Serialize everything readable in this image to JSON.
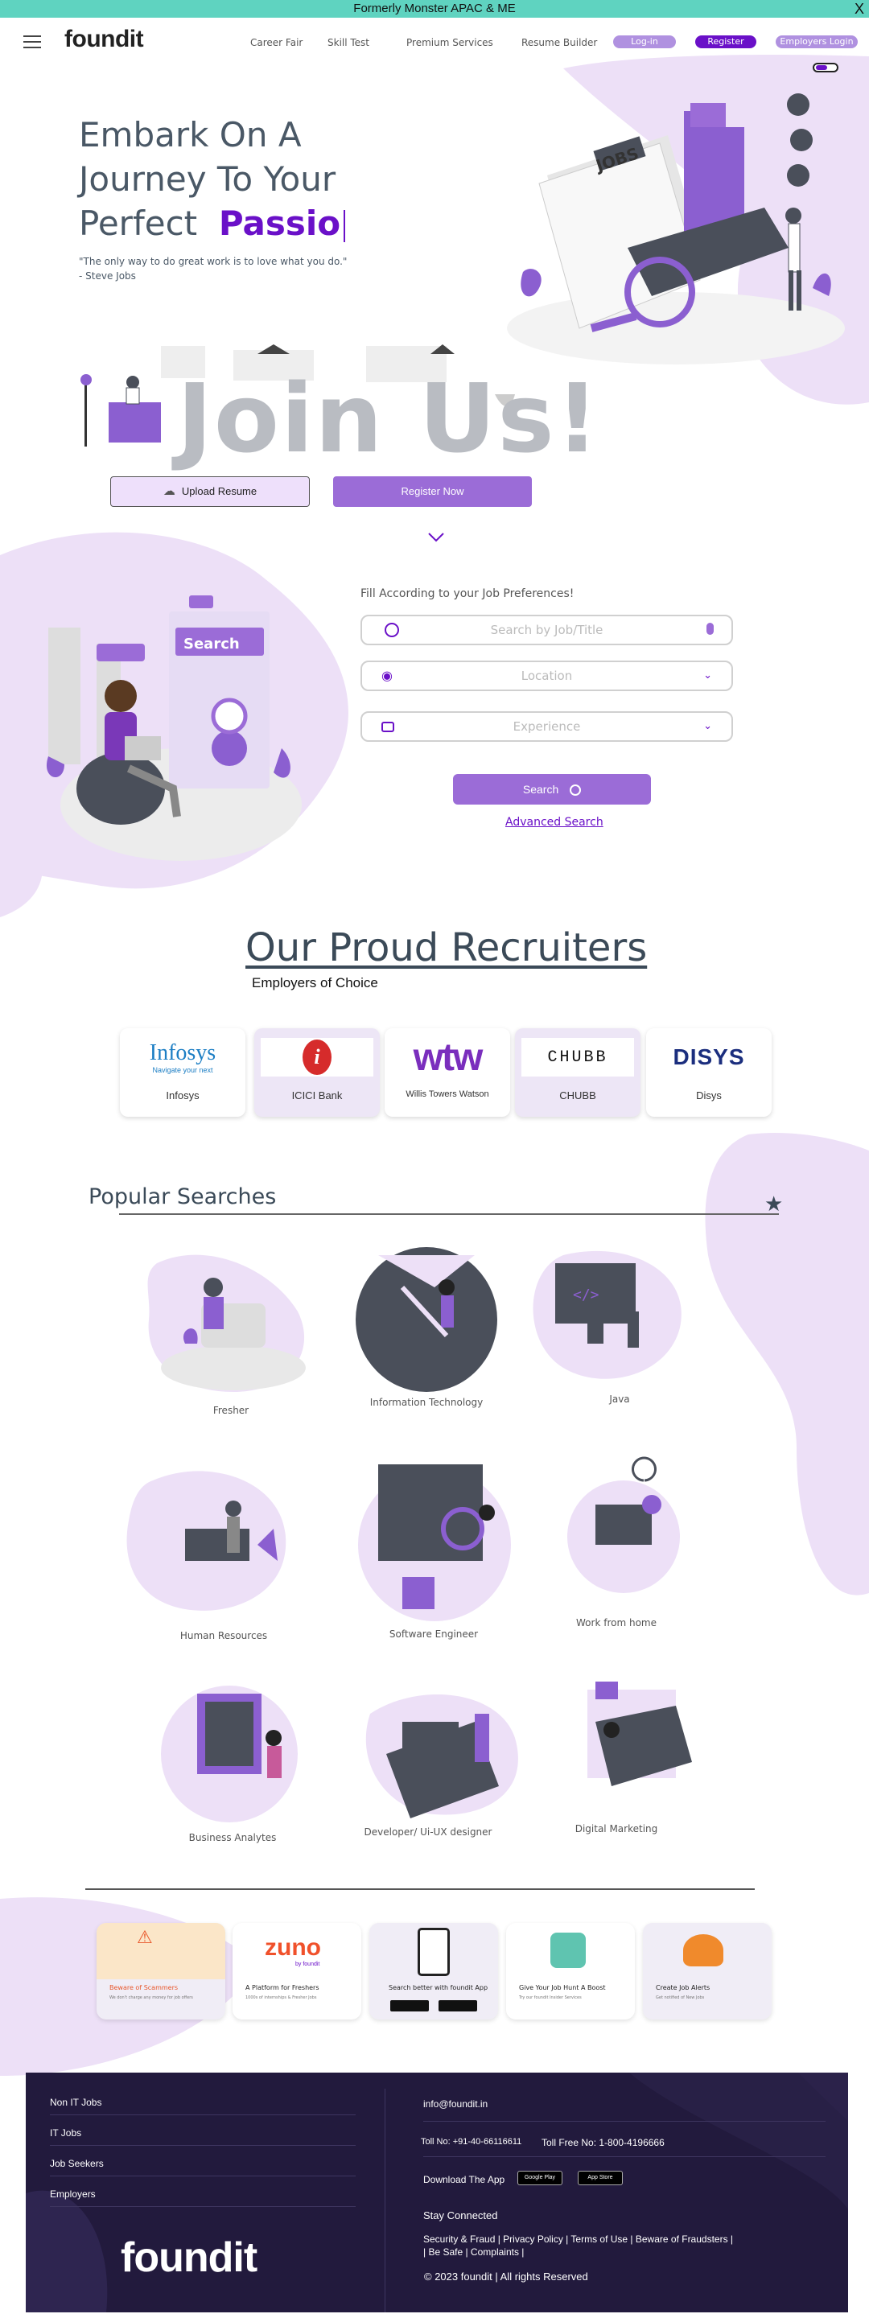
{
  "banner": {
    "text": "Formerly Monster APAC & ME",
    "close": "X"
  },
  "header": {
    "logo": "foundit",
    "links": [
      "Career Fair",
      "Skill Test",
      "Premium Services",
      "Resume Builder"
    ],
    "login": "Log-in",
    "register": "Register",
    "employers_login": "Employers Login"
  },
  "hero": {
    "line1": "Embark On A",
    "line2": "Journey To Your",
    "line3a": "Perfect",
    "line3b": "Passio",
    "quote": "\"The only way to do great work is to love what you do.\"",
    "author": "- Steve Jobs",
    "jobs_sign": "JOBS"
  },
  "join": {
    "title": "Join Us!",
    "upload": "Upload Resume",
    "register": "Register Now"
  },
  "search": {
    "heading": "Fill According to your Job Preferences!",
    "job_placeholder": "Search by Job/Title",
    "location_placeholder": "Location",
    "experience_placeholder": "Experience",
    "button": "Search",
    "advanced": "Advanced Search",
    "illus_label": "Search"
  },
  "recruiters": {
    "title": "Our Proud Recruiters",
    "subtitle": "Employers of Choice",
    "items": [
      {
        "logo": "Infosys",
        "tag": "Navigate your next",
        "name": "Infosys"
      },
      {
        "logo": "i",
        "tag": "",
        "name": "ICICI Bank"
      },
      {
        "logo": "wtw",
        "tag": "",
        "name": "Willis Towers Watson"
      },
      {
        "logo": "CHUBB",
        "tag": "",
        "name": "CHUBB"
      },
      {
        "logo": "DISYS",
        "tag": "",
        "name": "Disys"
      }
    ]
  },
  "popular": {
    "title": "Popular Searches",
    "items": [
      "Fresher",
      "Information Technology",
      "Java",
      "Human Resources",
      "Software Engineer",
      "Work from home",
      "Business Analytes",
      "Developer/ Ui-UX designer",
      "Digital Marketing"
    ]
  },
  "info_cards": [
    {
      "title": "Beware of Scammers",
      "sub": "We don't charge any money for job offers"
    },
    {
      "title": "A Platform for Freshers",
      "sub": "1000s of internships & Fresher Jobs",
      "logo": "zuno",
      "logo_sub": "by foundit"
    },
    {
      "title": "Search better with foundit App",
      "sub": ""
    },
    {
      "title": "Give Your Job Hunt A Boost",
      "sub": "Try our foundit Insider Services"
    },
    {
      "title": "Create Job Alerts",
      "sub": "Get notified of New Jobs"
    }
  ],
  "footer": {
    "links": [
      "Non IT Jobs",
      "IT Jobs",
      "Job Seekers",
      "Employers"
    ],
    "email": "info@foundit.in",
    "toll": "Toll No: +91-40-66116611",
    "tollfree": "Toll Free No: 1-800-4196666",
    "download": "Download The App",
    "google_play": "Google Play",
    "app_store": "App Store",
    "stay": "Stay Connected",
    "legal1": "Security & Fraud |  Privacy Policy  |  Terms of Use  |  Beware of Fraudsters  |",
    "legal2": "|  Be Safe  |  Complaints  |",
    "copyright": "© 2023 foundit | All rights Reserved",
    "logo": "foundit"
  },
  "colors": {
    "brand": "#6a10c8",
    "accent": "#9b6cd7",
    "blob": "#ede0f7",
    "footer": "#221a3d"
  }
}
